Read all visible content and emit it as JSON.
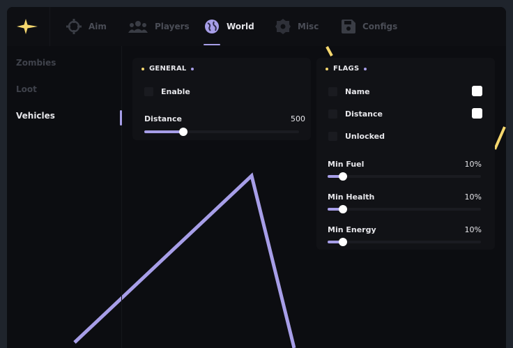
{
  "tabs": [
    {
      "label": "Aim",
      "icon": "crosshair-icon"
    },
    {
      "label": "Players",
      "icon": "users-icon"
    },
    {
      "label": "World",
      "icon": "globe-icon"
    },
    {
      "label": "Misc",
      "icon": "gear-icon"
    },
    {
      "label": "Configs",
      "icon": "floppy-disk-icon"
    }
  ],
  "active_tab": "World",
  "sidebar": {
    "items": [
      {
        "label": "Zombies"
      },
      {
        "label": "Loot"
      },
      {
        "label": "Vehicles"
      }
    ],
    "active": "Vehicles"
  },
  "general": {
    "title": "GENERAL",
    "enable": {
      "label": "Enable",
      "checked": false
    },
    "distance": {
      "label": "Distance",
      "value": "500",
      "fraction": 0.25
    }
  },
  "flags": {
    "title": "FLAGS",
    "name": {
      "label": "Name",
      "checked": false,
      "color": "#ffffff"
    },
    "distance": {
      "label": "Distance",
      "checked": false,
      "color": "#ffffff"
    },
    "unlocked": {
      "label": "Unlocked",
      "checked": false
    },
    "min_fuel": {
      "label": "Min Fuel",
      "value": "10%",
      "fraction": 0.1
    },
    "min_health": {
      "label": "Min Health",
      "value": "10%",
      "fraction": 0.1
    },
    "min_energy": {
      "label": "Min Energy",
      "value": "10%",
      "fraction": 0.1
    }
  },
  "colors": {
    "accent": "#a79ee8",
    "logo": "#f5d76e",
    "esp_line_yellow": "#f5d76e"
  }
}
